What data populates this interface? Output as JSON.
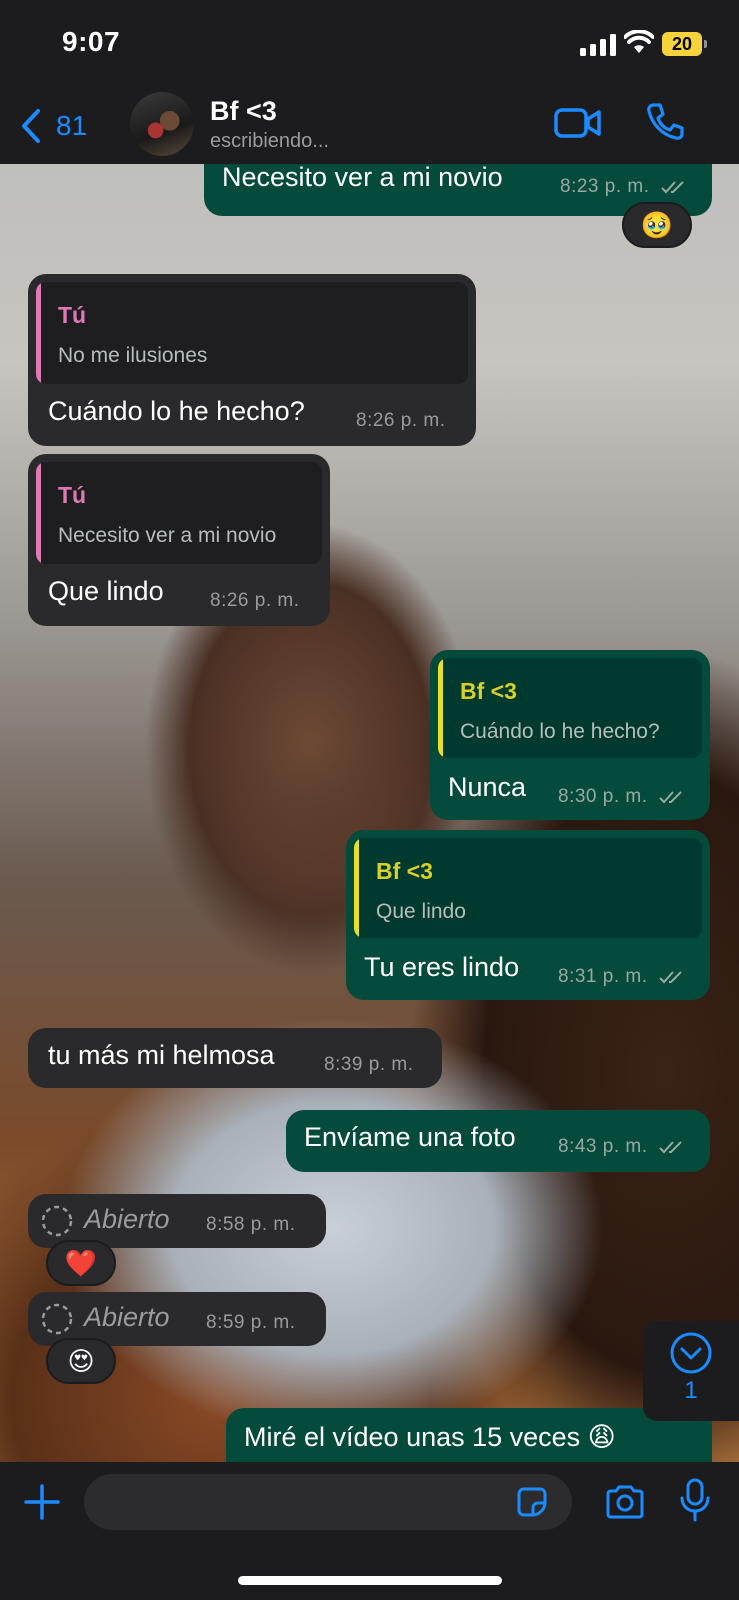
{
  "status_bar": {
    "time": "9:07",
    "battery": "20"
  },
  "header": {
    "back_count": "81",
    "contact_name": "Bf <3",
    "contact_status": "escribiendo..."
  },
  "messages": [
    {
      "text": "Necesito ver a mi novio",
      "time": "8:23 p. m.",
      "reaction": "🥹"
    },
    {
      "quote_name": "Tú",
      "quote_text": "No me ilusiones",
      "text": "Cuándo lo he hecho?",
      "time": "8:26 p. m."
    },
    {
      "quote_name": "Tú",
      "quote_text": "Necesito ver a mi novio",
      "text": "Que lindo",
      "time": "8:26 p. m."
    },
    {
      "quote_name": "Bf <3",
      "quote_text": "Cuándo lo he hecho?",
      "text": "Nunca",
      "time": "8:30 p. m."
    },
    {
      "quote_name": "Bf <3",
      "quote_text": "Que lindo",
      "text": "Tu eres lindo",
      "time": "8:31 p. m."
    },
    {
      "text": "tu más mi helmosa",
      "time": "8:39 p. m."
    },
    {
      "text": "Envíame una foto",
      "time": "8:43 p. m."
    },
    {
      "label": "Abierto",
      "time": "8:58 p. m.",
      "reaction": "❤️"
    },
    {
      "label": "Abierto",
      "time": "8:59 p. m.",
      "reaction": "😍"
    },
    {
      "text": "Miré el vídeo unas 15 veces 😩"
    }
  ],
  "scroll_down_badge": "1",
  "colors": {
    "accent": "#1a8cff",
    "outgoing_bubble": "#044b3b",
    "incoming_bubble": "#2a2a2c",
    "quote_self": "#e07ab6",
    "quote_contact": "#e6e02a",
    "read_ticks": "#9aa8a4"
  },
  "icons": [
    "back-chevron-icon",
    "video-call-icon",
    "phone-icon",
    "plus-icon",
    "sticker-icon",
    "camera-icon",
    "microphone-icon",
    "chevron-down-icon",
    "view-once-icon"
  ]
}
